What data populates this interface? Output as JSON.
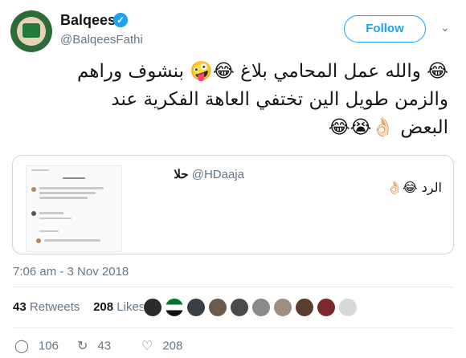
{
  "user": {
    "name": "Balqees",
    "handle": "@BalqeesFathi",
    "verified_mark": "✓"
  },
  "follow": {
    "label": "Follow"
  },
  "tweet": {
    "line1": "😂 والله عمل المحامي بلاغ 😂🤪 بنشوف وراهم",
    "line2": "والزمن طويل الين تختفي العاهة الفكرية عند",
    "line3": "البعض 👌🏻😭😂"
  },
  "quoted": {
    "author_name": "حلا",
    "author_handle": "@HDaaja",
    "text": "الرد 😂👌🏻"
  },
  "timestamp": "7:06 am - 3 Nov 2018",
  "stats": {
    "retweets_count": "43",
    "retweets_label": "Retweets",
    "likes_count": "208",
    "likes_label": "Likes"
  },
  "actions": {
    "replies": "106",
    "retweets": "43",
    "likes": "208"
  },
  "colors": {
    "accent": "#1da1f2",
    "muted": "#657786",
    "border": "#e6ecf0"
  }
}
